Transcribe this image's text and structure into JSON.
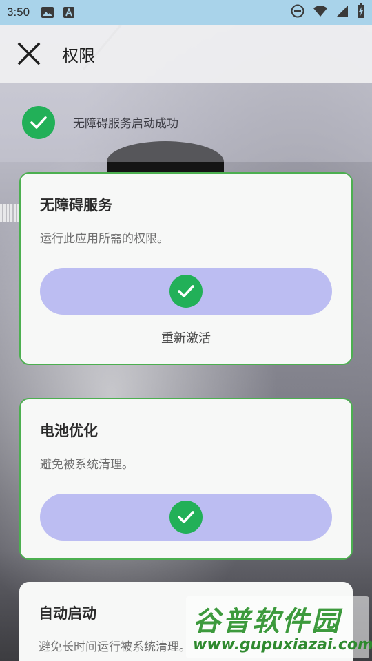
{
  "status_bar": {
    "time": "3:50",
    "icons": [
      "image-icon",
      "font-icon",
      "do-not-disturb-icon",
      "wifi-icon",
      "signal-icon",
      "battery-icon"
    ]
  },
  "app_bar": {
    "title": "权限",
    "close_icon": "close-icon"
  },
  "banner": {
    "text": "无障碍服务启动成功",
    "icon": "check-circle-icon"
  },
  "cards": [
    {
      "title": "无障碍服务",
      "description": "运行此应用所需的权限。",
      "granted": true,
      "link": "重新激活"
    },
    {
      "title": "电池优化",
      "description": "避免被系统清理。",
      "granted": true
    },
    {
      "title": "自动启动",
      "description": "避免长时间运行被系统清理。"
    }
  ],
  "watermark": {
    "title": "谷普软件园",
    "url": "www.gupuxiazai.com"
  },
  "colors": {
    "status_bar": "#a9d3ea",
    "check_green": "#22b058",
    "card_border": "#4caf50",
    "button_fill": "#bcbdf2",
    "card_background": "#f7f8f7"
  }
}
